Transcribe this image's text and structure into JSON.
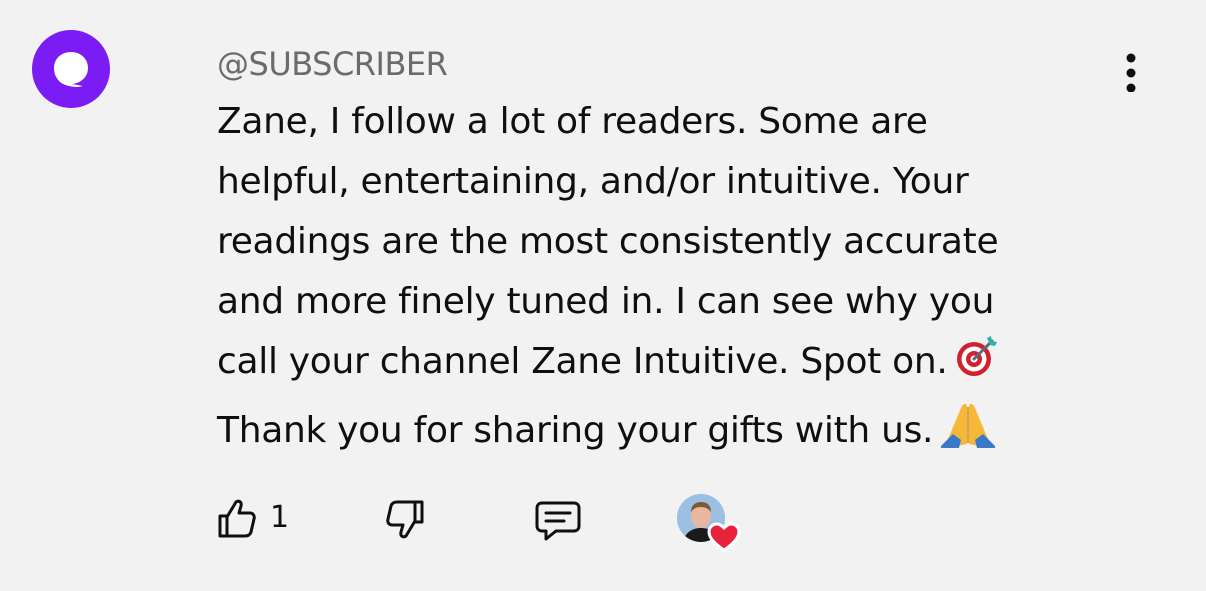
{
  "comment": {
    "author_handle": "@SUBSCRIBER",
    "lines": [
      "Zane, I follow a lot of readers. Some are",
      "helpful, entertaining, and/or intuitive. Your",
      "readings are the most consistently accurate",
      "and more finely tuned in. I can see why you",
      "call your channel Zane Intuitive. Spot on.",
      "Thank you for sharing your gifts with us."
    ],
    "line5_emoji": "direct-hit-target-emoji",
    "line6_emoji": "folded-hands-emoji"
  },
  "actions": {
    "like_count": "1",
    "like_icon": "thumbs-up-icon",
    "dislike_icon": "thumbs-down-icon",
    "reply_icon": "comment-reply-icon",
    "creator_heart_icon": "creator-heart-icon"
  },
  "colors": {
    "background": "#f2f2f2",
    "avatar": "#7a1cf3",
    "handle_text": "#6b6b6b",
    "body_text": "#0f0f0f",
    "heart": "#e8223a"
  }
}
